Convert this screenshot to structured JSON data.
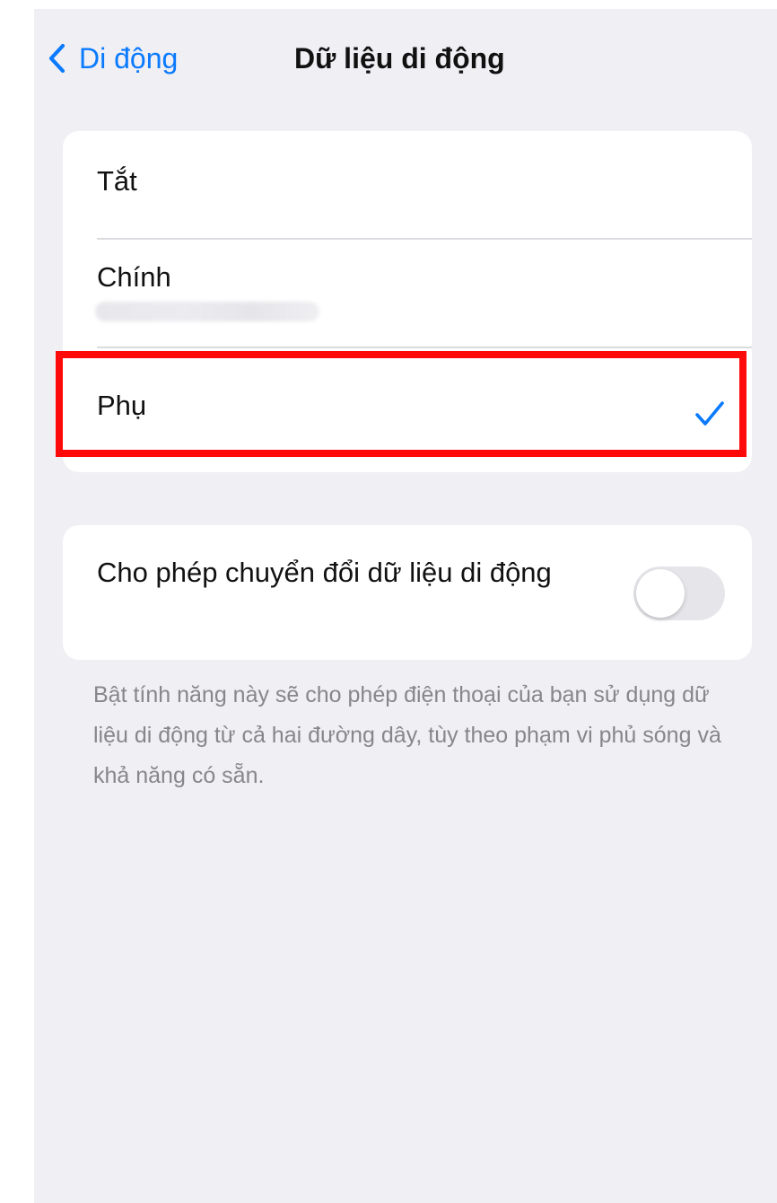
{
  "nav": {
    "back_label": "Di động",
    "title": "Dữ liệu di động"
  },
  "sim_options": {
    "items": [
      {
        "label": "Tắt",
        "selected": false
      },
      {
        "label": "Chính",
        "selected": false
      },
      {
        "label": "Phụ",
        "selected": true
      }
    ]
  },
  "data_switching": {
    "label": "Cho phép chuyển đổi dữ liệu di động",
    "enabled": false,
    "footer": "Bật tính năng này sẽ cho phép điện thoại của bạn sử dụng dữ liệu di động từ cả hai đường dây, tùy theo phạm vi phủ sóng và khả năng có sẵn."
  },
  "colors": {
    "accent": "#0a7aff",
    "highlight": "#ff0a0a",
    "background": "#efeff4",
    "switch_off": "#e5e5ea"
  }
}
